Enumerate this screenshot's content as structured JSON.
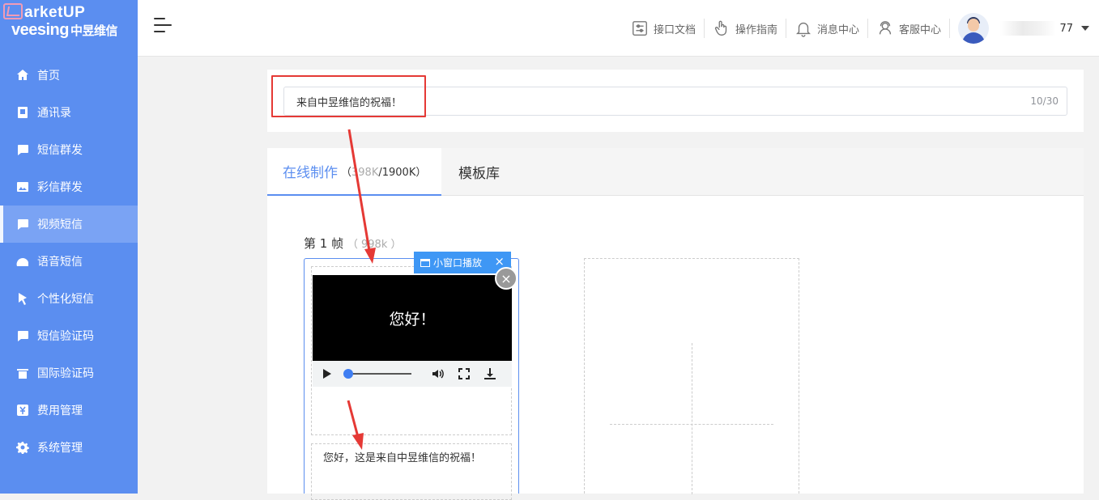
{
  "logo": {
    "brand_top": "arketUP",
    "brand_main": "veesing",
    "brand_cn": "中昱维信"
  },
  "sidebar": {
    "items": [
      {
        "label": "首页",
        "icon": "home-icon"
      },
      {
        "label": "通讯录",
        "icon": "contacts-icon"
      },
      {
        "label": "短信群发",
        "icon": "sms-icon"
      },
      {
        "label": "彩信群发",
        "icon": "image-message-icon"
      },
      {
        "label": "视频短信",
        "icon": "video-message-icon"
      },
      {
        "label": "语音短信",
        "icon": "voice-icon"
      },
      {
        "label": "个性化短信",
        "icon": "personalized-icon"
      },
      {
        "label": "短信验证码",
        "icon": "verification-icon"
      },
      {
        "label": "国际验证码",
        "icon": "international-icon"
      },
      {
        "label": "费用管理",
        "icon": "yen-icon"
      },
      {
        "label": "系统管理",
        "icon": "gear-icon"
      }
    ],
    "active_index": 4
  },
  "header": {
    "nav": [
      {
        "label": "接口文档",
        "icon": "api-doc-icon"
      },
      {
        "label": "操作指南",
        "icon": "hand-pointer-icon"
      },
      {
        "label": "消息中心",
        "icon": "bell-icon"
      },
      {
        "label": "客服中心",
        "icon": "service-icon"
      }
    ],
    "user_suffix": "77"
  },
  "title_field": {
    "value": "来自中昱维信的祝福！",
    "count": "10/30"
  },
  "tabs": {
    "online_label": "在线制作",
    "online_size_open": "（",
    "online_size_used": "398K",
    "online_size_total": "/1900K",
    "online_size_close": "）",
    "template_label": "模板库"
  },
  "frame": {
    "label": "第 1 帧",
    "size": "（ 998k ）",
    "video_caption": "您好！",
    "text": "您好，这是来自中昱维信的祝福！",
    "pip_label": "小窗口播放",
    "pip_close": "×",
    "remove": "×"
  },
  "player": {
    "progress": 0.0
  },
  "colors": {
    "sidebar": "#5b8ef0",
    "accent": "#5b8ef0",
    "annotation": "#e53935",
    "pip": "#3e97f5"
  }
}
